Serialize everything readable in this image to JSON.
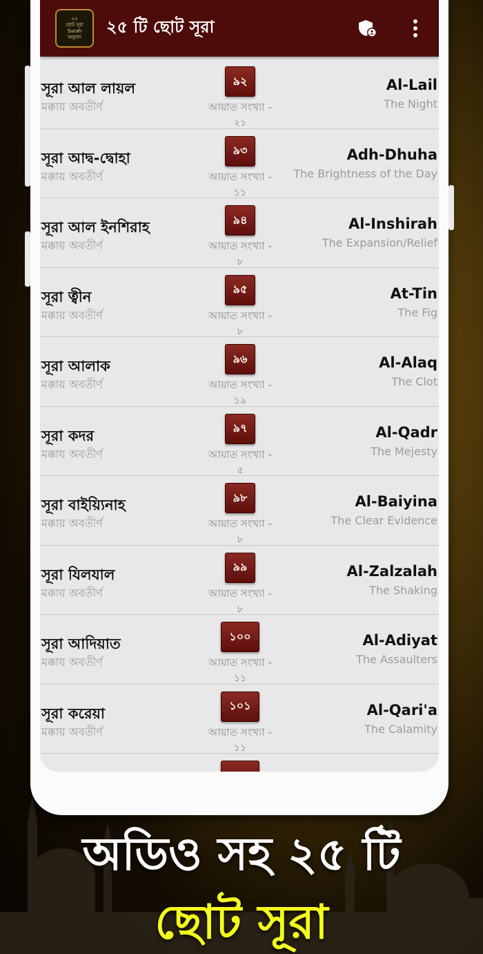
{
  "app": {
    "title": "২৫ টি ছোট সূরা",
    "logo_lines": [
      "২৫",
      "ছোট সূরা",
      "Surah",
      "অনুবাদ"
    ]
  },
  "icons": {
    "privacy": "shield-person-icon",
    "menu": "more-vertical-icon"
  },
  "colors": {
    "appbar": "#4d0b0a",
    "badge": "#7a1d17",
    "caption_highlight": "#f4ff1c"
  },
  "surahs": [
    {
      "bn": "সূরা আল লায়ল",
      "revelation": "মক্কায় অবতীর্ণ",
      "number": "৯২",
      "ayat_label": "আয়াত সংখ্যা -",
      "ayat": "২১",
      "en": "Al-Lail",
      "meaning": "The Night"
    },
    {
      "bn": "সূরা আদ্ব-দ্বোহা",
      "revelation": "মক্কায় অবতীর্ণ",
      "number": "৯৩",
      "ayat_label": "আয়াত সংখ্যা -",
      "ayat": "১১",
      "en": "Adh-Dhuha",
      "meaning": "The Brightness of the Day"
    },
    {
      "bn": "সূরা আল ইনশিরাহ",
      "revelation": "মক্কায় অবতীর্ণ",
      "number": "৯৪",
      "ayat_label": "আয়াত সংখ্যা -",
      "ayat": "৮",
      "en": "Al-Inshirah",
      "meaning": "The Expansion/Relief"
    },
    {
      "bn": "সূরা ত্বীন",
      "revelation": "মক্কায় অবতীর্ণ",
      "number": "৯৫",
      "ayat_label": "আয়াত সংখ্যা -",
      "ayat": "৮",
      "en": "At-Tin",
      "meaning": "The Fig"
    },
    {
      "bn": "সূরা আলাক",
      "revelation": "মক্কায় অবতীর্ণ",
      "number": "৯৬",
      "ayat_label": "আয়াত সংখ্যা -",
      "ayat": "১৯",
      "en": "Al-Alaq",
      "meaning": "The Clot"
    },
    {
      "bn": "সূরা কদর",
      "revelation": "মক্কায় অবতীর্ণ",
      "number": "৯৭",
      "ayat_label": "আয়াত সংখ্যা -",
      "ayat": "৫",
      "en": "Al-Qadr",
      "meaning": "The Mejesty"
    },
    {
      "bn": "সূরা বাইয়্যিনাহ",
      "revelation": "মক্কায় অবতীর্ণ",
      "number": "৯৮",
      "ayat_label": "আয়াত সংখ্যা -",
      "ayat": "৮",
      "en": "Al-Baiyina",
      "meaning": "The Clear Evidence"
    },
    {
      "bn": "সূরা যিলযাল",
      "revelation": "মক্কায় অবতীর্ণ",
      "number": "৯৯",
      "ayat_label": "আয়াত সংখ্যা -",
      "ayat": "৮",
      "en": "Al-Zalzalah",
      "meaning": "The Shaking"
    },
    {
      "bn": "সূরা আদিয়াত",
      "revelation": "মক্কায় অবতীর্ণ",
      "number": "১০০",
      "ayat_label": "আয়াত সংখ্যা -",
      "ayat": "১১",
      "en": "Al-Adiyat",
      "meaning": "The Assaulters"
    },
    {
      "bn": "সূরা করেয়া",
      "revelation": "মক্কায় অবতীর্ণ",
      "number": "১০১",
      "ayat_label": "আয়াত সংখ্যা -",
      "ayat": "১১",
      "en": "Al-Qari'a",
      "meaning": "The Calamity"
    }
  ],
  "promo": {
    "line1": "অডিও সহ ২৫ টি",
    "line2": "ছোট সূরা"
  }
}
